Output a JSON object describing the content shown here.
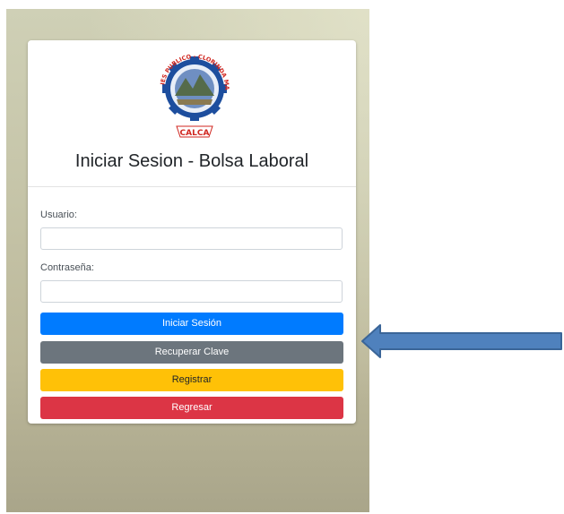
{
  "logo": {
    "ring_text": "IES PUBLICO - CLORINDA MATTO DE TURNER",
    "place_text": "CALCA"
  },
  "login": {
    "title": "Iniciar Sesion - Bolsa Laboral",
    "username_label": "Usuario:",
    "username_value": "",
    "password_label": "Contraseña:",
    "password_value": ""
  },
  "buttons": {
    "login": "Iniciar Sesión",
    "recover": "Recuperar Clave",
    "register": "Registrar",
    "back": "Regresar"
  },
  "colors": {
    "primary": "#007bff",
    "secondary": "#6c757d",
    "warning": "#ffc107",
    "danger": "#dc3545",
    "arrow": "#4f81bd"
  }
}
